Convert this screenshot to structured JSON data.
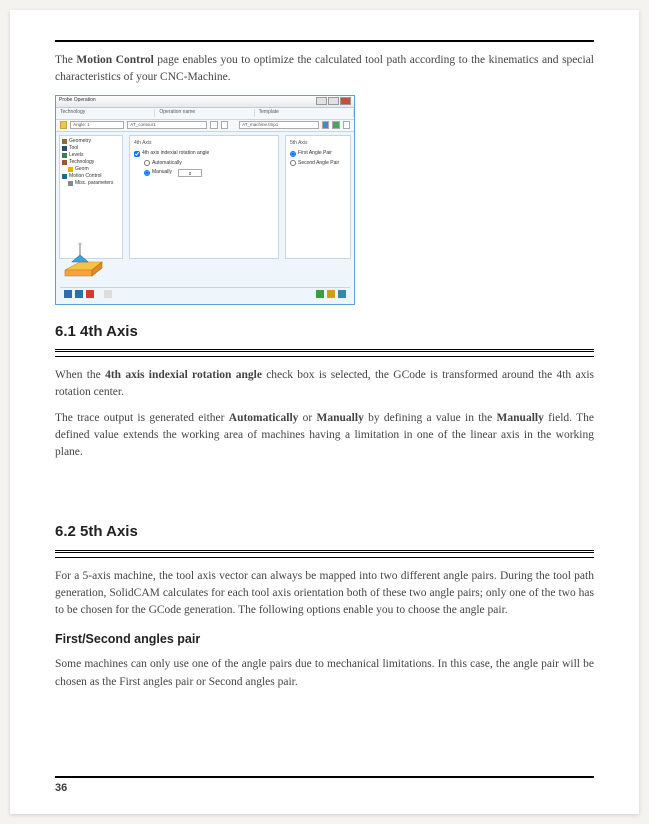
{
  "intro": {
    "prefix": "The ",
    "motion_control": "Motion Control",
    "suffix": " page enables you to optimize the calculated tool path according to the kinematics and special characteristics of your CNC-Machine."
  },
  "app": {
    "title": "Probe Operation",
    "tab_technology": "Technology",
    "tab_operation_name": "Operation name",
    "tab_template": "Template",
    "technology_val": "Angle: 1",
    "operation_val": "AT_contour1",
    "template_val": "AT_machine.tmp1",
    "tree": {
      "geometry": "Geometry",
      "tool": "Tool",
      "levels": "Levels",
      "technology": "Technology",
      "geom": "Geom",
      "motion_control": "Motion Control",
      "misc_parameters": "Misc. parameters"
    },
    "panel4": {
      "title": "4th Axis",
      "checkbox": "4th axis indexial rotation angle",
      "auto": "Automatically",
      "manual": "Manually",
      "value": "0"
    },
    "panel5": {
      "title": "5th Axis",
      "opt1": "First Angle Pair",
      "opt2": "Second Angle Pair"
    }
  },
  "s61": {
    "heading": "6.1   4th Axis",
    "p1a": "When the ",
    "p1b": "4th axis indexial rotation angle",
    "p1c": " check box is selected, the GCode is transformed around the 4th axis rotation center.",
    "p2a": "The trace output is generated either ",
    "auto": "Automatically",
    "p2b": " or ",
    "manual": "Manually",
    "p2c": " by defining a value in the ",
    "manual2": "Manually",
    "p2d": " field. The defined value extends the working area of machines having a limitation in one of the linear axis in the working plane."
  },
  "s62": {
    "heading": "6.2   5th Axis",
    "p1": "For a 5-axis machine, the tool axis vector can always be mapped into two different angle pairs. During the tool path generation, SolidCAM calculates for each tool axis orientation both of these two angle pairs; only one of the two has to be chosen for the GCode generation. The following options enable you to choose the angle pair.",
    "sub": "First/Second angles pair",
    "p2": "Some machines can only use one of the angle pairs due to mechanical limitations. In this case, the angle pair will be chosen as the First angles pair or Second angles pair."
  },
  "page_number": "36"
}
